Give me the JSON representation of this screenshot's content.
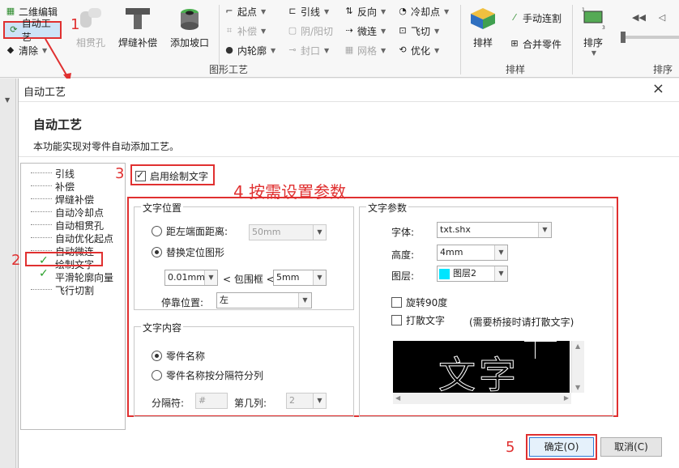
{
  "ribbon": {
    "qr_edit": "二维编辑",
    "auto_process": "自动工艺",
    "clear": "清除",
    "pierce": "相贯孔",
    "weld_comp": "焊缝补偿",
    "add_bevel": "添加坡口",
    "start_point": "起点",
    "compensate": "补偿",
    "inner_contour": "内轮廓",
    "lead_line": "引线",
    "yin_yang": "阴/阳切",
    "seal": "封口",
    "reverse": "反向",
    "micro_joint": "微连",
    "grid": "网格",
    "cool_point": "冷却点",
    "fly_cut": "飞切",
    "optimize": "优化",
    "group_graphic": "图形工艺",
    "nest": "排样",
    "manual_joint": "手动连割",
    "merge_parts": "合并零件",
    "group_nest": "排样",
    "sort": "排序",
    "group_sort": "排序"
  },
  "dialog": {
    "title": "自动工艺",
    "close": "×",
    "heading": "自动工艺",
    "description": "本功能实现对零件自动添加工艺。"
  },
  "tree": [
    "引线",
    "补偿",
    "焊缝补偿",
    "自动冷却点",
    "自动相贯孔",
    "自动优化起点",
    "自动微连",
    "绘制文字",
    "平滑轮廓向量",
    "飞行切割"
  ],
  "enable_draw_text": "启用绘制文字",
  "text_position": {
    "legend": "文字位置",
    "distance_label": "距左端面距离:",
    "distance_value": "50mm",
    "replace_label": "替换定位图形",
    "tolerance_value": "0.01mm",
    "bbox_label": "< 包围框 <",
    "bbox_value": "5mm",
    "dock_label": "停靠位置:",
    "dock_value": "左"
  },
  "text_content": {
    "legend": "文字内容",
    "part_name": "零件名称",
    "part_name_split": "零件名称按分隔符分列",
    "separator_label": "分隔符:",
    "separator_value": "#",
    "column_label": "第几列:",
    "column_value": "2"
  },
  "text_params": {
    "legend": "文字参数",
    "font_label": "字体:",
    "font_value": "txt.shx",
    "height_label": "高度:",
    "height_value": "4mm",
    "layer_label": "图层:",
    "layer_value": "图层2",
    "layer_color": "#00e5ff",
    "rotate_label": "旋转90度",
    "scatter_label": "打散文字",
    "scatter_note": "(需要桥接时请打散文字)",
    "preview_text": "文字"
  },
  "buttons": {
    "ok": "确定(O)",
    "cancel": "取消(C)"
  },
  "annotations": {
    "a1": "1",
    "a2": "2",
    "a3": "3",
    "a4": "4 按需设置参数",
    "a5": "5"
  }
}
